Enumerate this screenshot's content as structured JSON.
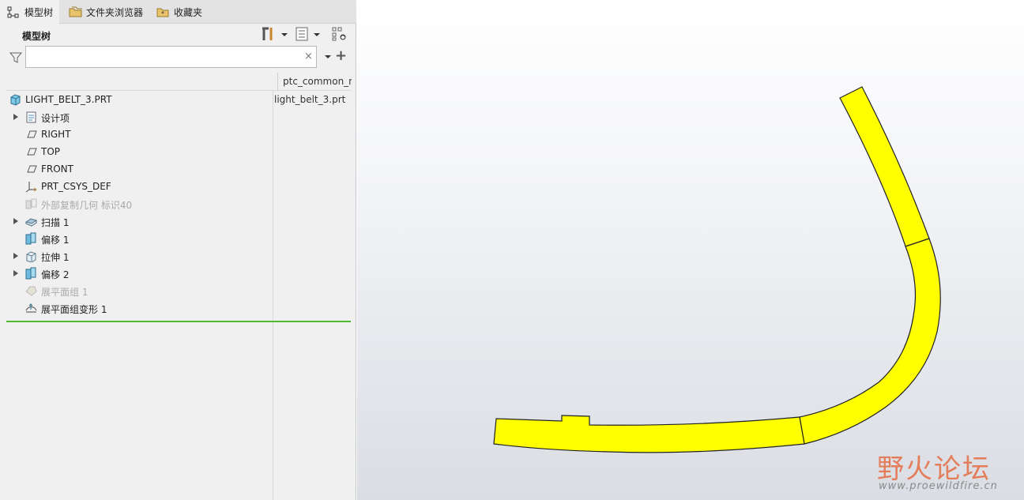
{
  "tabs": [
    {
      "label": "模型树",
      "icon": "model-tree-icon",
      "active": true
    },
    {
      "label": "文件夹浏览器",
      "icon": "folder-browser-icon",
      "active": false
    },
    {
      "label": "收藏夹",
      "icon": "favorites-icon",
      "active": false
    }
  ],
  "tree_header": {
    "title": "模型树"
  },
  "filter": {
    "value": "",
    "placeholder": "",
    "clear_glyph": "×",
    "add_glyph": "+"
  },
  "columns": {
    "name": "ptc_common_na"
  },
  "tree": {
    "root": {
      "label": "LIGHT_BELT_3.PRT",
      "value": "light_belt_3.prt"
    },
    "items": [
      {
        "label": "设计项",
        "icon": "design-items-icon",
        "expandable": true,
        "disabled": false
      },
      {
        "label": "RIGHT",
        "icon": "datum-plane-icon",
        "expandable": false,
        "disabled": false
      },
      {
        "label": "TOP",
        "icon": "datum-plane-icon",
        "expandable": false,
        "disabled": false
      },
      {
        "label": "FRONT",
        "icon": "datum-plane-icon",
        "expandable": false,
        "disabled": false
      },
      {
        "label": "PRT_CSYS_DEF",
        "icon": "coordinate-system-icon",
        "expandable": false,
        "disabled": false
      },
      {
        "label": "外部复制几何 标识40",
        "icon": "external-copy-geometry-icon",
        "expandable": false,
        "disabled": true
      },
      {
        "label": "扫描 1",
        "icon": "sweep-icon",
        "expandable": true,
        "disabled": false
      },
      {
        "label": "偏移 1",
        "icon": "offset-icon",
        "expandable": false,
        "disabled": false
      },
      {
        "label": "拉伸 1",
        "icon": "extrude-icon",
        "expandable": true,
        "disabled": false
      },
      {
        "label": "偏移 2",
        "icon": "offset-icon",
        "expandable": true,
        "disabled": false
      },
      {
        "label": "展平面组 1",
        "icon": "flatten-quilt-icon",
        "expandable": false,
        "disabled": true
      },
      {
        "label": "展平面组变形 1",
        "icon": "flatten-quilt-deform-icon",
        "expandable": false,
        "disabled": false
      }
    ]
  },
  "colors": {
    "model_fill": "#ffff00",
    "insert_line": "#4fba2e",
    "watermark": "#e4734c"
  },
  "watermark": {
    "title": "野火论坛",
    "url": "www.proewildfire.cn"
  }
}
